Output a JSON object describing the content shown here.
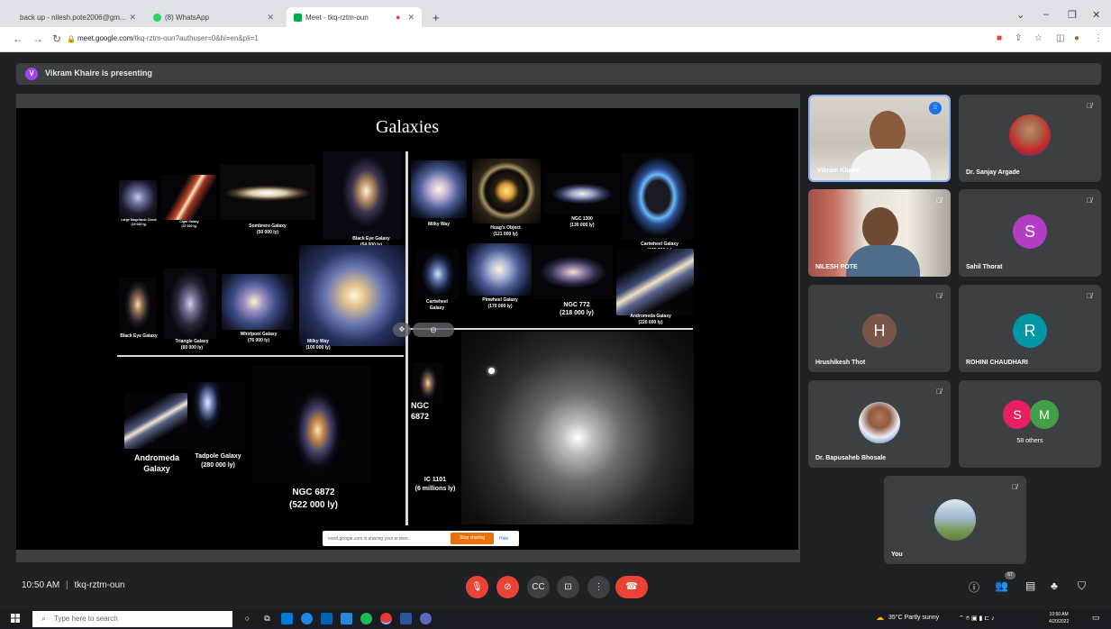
{
  "browser": {
    "tabs": [
      {
        "title": "back up - nilesh.pote2006@gm...",
        "favicon": "gmail-icon",
        "color": "#ea4335"
      },
      {
        "title": "(8) WhatsApp",
        "favicon": "whatsapp-icon",
        "color": "#25d366"
      },
      {
        "title": "Meet - tkq-rztm-oun",
        "favicon": "meet-icon",
        "color": "#00ac47"
      }
    ],
    "new_tab": "+",
    "url_host": "meet.google.com",
    "url_path": "/tkq-rztm-oun?authuser=0&hl=en&pli=1"
  },
  "meet": {
    "presenting_avatar_initial": "V",
    "presenting_text": "Vikram Khaire is presenting",
    "time": "10:50 AM",
    "separator": "|",
    "meeting_code": "tkq-rztm-oun",
    "people_count": "67"
  },
  "slide": {
    "title": "Galaxies",
    "labels": {
      "lmc": "Large Magellanic Cloud\n(16 000 ly)",
      "cigar": "Cigar Galaxy\n(37 000 ly)",
      "sombrero": "Sombrero Galaxy\n(50 000 ly)",
      "blackeye_top": "Black Eye Galaxy\n(54 000 ly)",
      "blackeye_left": "Black Eye Galaxy",
      "triangle": "Triangle Galaxy\n(60 000 ly)",
      "whirlpool": "Whirlpool Galaxy\n(76 000 ly)",
      "milkyway_left": "Milky Way\n(100 000 ly)",
      "milkyway_right": "Milky Way",
      "hoag": "Hoag's Object\n(121 000 ly)",
      "ngc1300": "NGC 1300\n(130 000 ly)",
      "cartwheel_big": "Cartwheel Galaxy\n(150 000 ly)",
      "cartwheel_small": "Cartwheel\nGalaxy",
      "pinwheel": "Pinwheel Galaxy\n(170 000 ly)",
      "ngc772": "NGC 772\n(218 000 ly)",
      "andromeda_top": "Andromeda Galaxy\n(220 000 ly)",
      "andromeda_bottom": "Andromeda\nGalaxy",
      "tadpole": "Tadpole Galaxy\n(280 000 ly)",
      "ngc6872_big": "NGC 6872\n(522 000 ly)",
      "ngc6872_small": "NGC\n6872",
      "ic1101": "IC 1101\n(6 millions ly)"
    }
  },
  "share_banner": {
    "text": "meet.google.com is sharing your screen.",
    "stop": "Stop sharing",
    "hide": "Hide"
  },
  "participants": [
    {
      "name": "Vikram Khaire"
    },
    {
      "name": "Dr. Sanjay Argade"
    },
    {
      "name": "NILESH POTE"
    },
    {
      "name": "Sahil Thorat",
      "initial": "S",
      "color": "#b43dc6"
    },
    {
      "name": "Hrushikesh Thot",
      "initial": "H",
      "color": "#795548"
    },
    {
      "name": "ROHINI CHAUDHARI",
      "initial": "R",
      "color": "#0097a7"
    },
    {
      "name": "Dr. Bapusaheb Bhosale"
    },
    {
      "name": "58 others",
      "initials": [
        "S",
        "M"
      ],
      "colors": [
        "#e91e63",
        "#43a047"
      ]
    },
    {
      "name": "You"
    }
  ],
  "taskbar": {
    "search_placeholder": "Type here to search",
    "weather": "35°C  Partly sunny",
    "clock_time": "10:50 AM",
    "clock_date": "4/20/2022"
  }
}
